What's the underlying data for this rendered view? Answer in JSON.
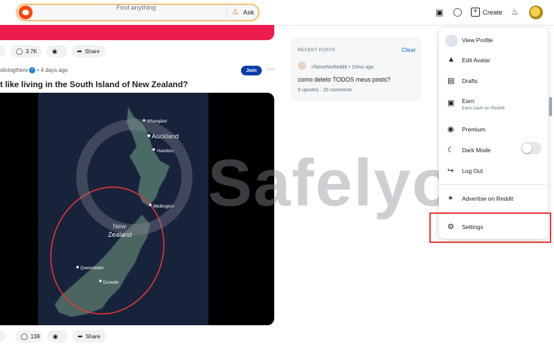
{
  "header": {
    "search_placeholder": "Find anything",
    "ask_label": "Ask",
    "create_label": "Create"
  },
  "feed": {
    "top_post": {
      "comments": "3.7K",
      "share_label": "Share"
    },
    "post": {
      "author": "slivingthere",
      "time": "• 4 days ago",
      "join_label": "Join",
      "title": "t like living in the South Island of New Zealand?",
      "comments": "138",
      "share_label": "Share",
      "map_labels": [
        "Whangārei",
        "Auckland",
        "Hamilton",
        "Wellington",
        "New",
        "Zealand",
        "Queenstown",
        "Dunedin"
      ]
    }
  },
  "recent": {
    "title": "RECENT POSTS",
    "clear_label": "Clear",
    "items": [
      {
        "subreddit": "r/NovoNoReddit • 10mo ago",
        "title": "como deleto TODOS meus posts?",
        "stats": "9 upvotes · 20 comments"
      }
    ]
  },
  "menu": {
    "items": [
      {
        "label": "View Profile",
        "icon": "avatar"
      },
      {
        "label": "Edit Avatar",
        "icon": "shirt-icon"
      },
      {
        "label": "Drafts",
        "icon": "drafts-icon"
      },
      {
        "label": "Earn",
        "sub": "Earn cash on Reddit",
        "icon": "earn-icon"
      },
      {
        "label": "Premium",
        "icon": "premium-icon"
      },
      {
        "label": "Dark Mode",
        "icon": "moon-icon"
      },
      {
        "label": "Log Out",
        "icon": "logout-icon"
      },
      {
        "label": "Advertise on Reddit",
        "icon": "advertise-icon"
      },
      {
        "label": "Settings",
        "icon": "gear-icon"
      }
    ],
    "dark_mode_on": false
  },
  "watermark": {
    "text": "Safelyo"
  },
  "colors": {
    "accent": "#ff4500",
    "join": "#0a3ca8",
    "highlight": "#e53935",
    "banner": "#ec1c4f"
  }
}
